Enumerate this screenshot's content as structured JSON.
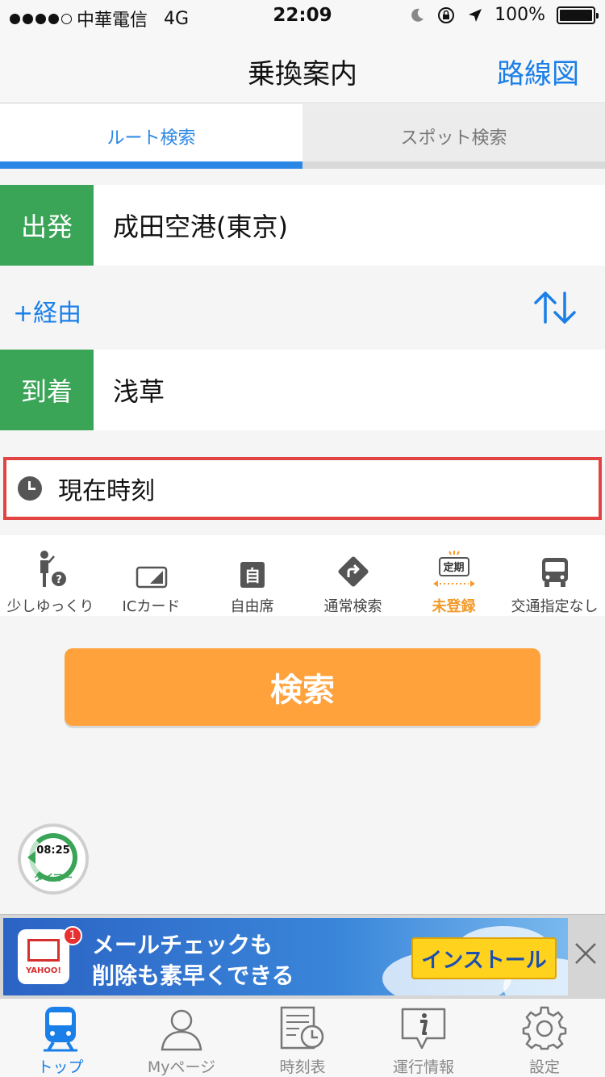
{
  "status_bar": {
    "carrier": "中華電信",
    "network": "4G",
    "time": "22:09",
    "battery": "100%"
  },
  "navbar": {
    "title": "乗換案内",
    "right_button": "路線図"
  },
  "tabs": [
    {
      "label": "ルート検索",
      "active": true
    },
    {
      "label": "スポット検索",
      "active": false
    }
  ],
  "departure": {
    "label": "出発",
    "value": "成田空港(東京)"
  },
  "via": {
    "label": "+経由"
  },
  "arrival": {
    "label": "到着",
    "value": "浅草"
  },
  "time_field": {
    "value": "現在時刻"
  },
  "options": [
    {
      "label": "少しゆっくり",
      "icon": "walking-person-icon"
    },
    {
      "label": "ICカード",
      "icon": "ic-card-icon"
    },
    {
      "label": "自由席",
      "icon": "seat-icon"
    },
    {
      "label": "通常検索",
      "icon": "route-sign-icon"
    },
    {
      "label": "未登録",
      "icon": "commuter-pass-icon",
      "badge": "定期"
    },
    {
      "label": "交通指定なし",
      "icon": "bus-icon"
    }
  ],
  "search_button": {
    "label": "検索"
  },
  "timer": {
    "time": "08:25",
    "label": "タイマー"
  },
  "ad": {
    "line1": "メールチェックも",
    "line2": "削除も素早くできる",
    "install": "インストール",
    "badge_count": "1",
    "app_brand": "YAHOO!"
  },
  "tabbar": [
    {
      "label": "トップ",
      "active": true
    },
    {
      "label": "Myページ",
      "active": false
    },
    {
      "label": "時刻表",
      "active": false
    },
    {
      "label": "運行情報",
      "active": false
    },
    {
      "label": "設定",
      "active": false
    }
  ],
  "colors": {
    "accent_blue": "#1a7fe8",
    "label_green": "#3aa457",
    "search_orange": "#ffa23b",
    "highlight_red": "#e24444"
  }
}
